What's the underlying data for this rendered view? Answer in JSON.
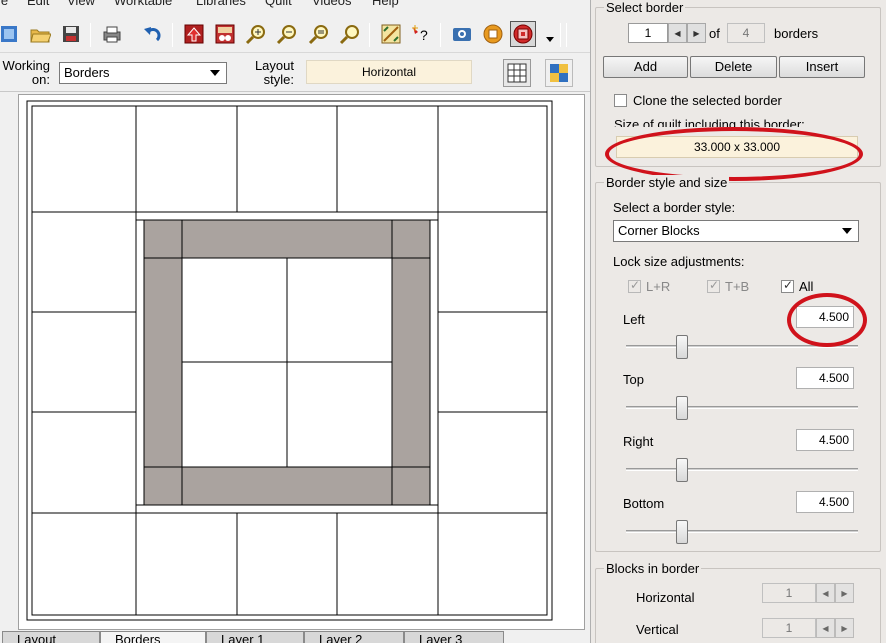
{
  "menu": {
    "items": [
      "le",
      "Edit",
      "View",
      "Worktable",
      "Libraries",
      "Quilt",
      "Videos",
      "Help"
    ]
  },
  "toolbar": {
    "icons": [
      "new-icon",
      "open-icon",
      "save-icon",
      "print-icon",
      "undo-icon",
      "add-to-sketchbook-icon",
      "view-sketchbook-icon",
      "zoom-in-icon",
      "zoom-out-icon",
      "fit-to-worktable-icon",
      "refresh-icon",
      "color-palette-icon",
      "help-icon",
      "camera-icon",
      "draw-icon",
      "target-icon"
    ]
  },
  "workbar": {
    "working_on_label": "Working on:",
    "working_on_value": "Borders",
    "layout_style_label": "Layout style:",
    "layout_style_value": "Horizontal"
  },
  "bottom_tabs": [
    "Layout",
    "Borders",
    "Layer 1",
    "Layer 2",
    "Layer 3"
  ],
  "active_tab": "Borders",
  "select_border": {
    "title": "Select border",
    "current": "1",
    "of_label": "of",
    "total": "4",
    "borders_label": "borders",
    "add_label": "Add",
    "delete_label": "Delete",
    "insert_label": "Insert",
    "clone_label": "Clone the selected border",
    "clone_checked": false,
    "size_label": "Size of quilt including this border:",
    "size_value": "33.000 x 33.000"
  },
  "border_style": {
    "title": "Border style and size",
    "select_label": "Select a border style:",
    "style_value": "Corner Blocks",
    "lock_label": "Lock size adjustments:",
    "lock_lr_label": "L+R",
    "lock_tb_label": "T+B",
    "lock_all_label": "All",
    "lock_lr_checked": true,
    "lock_tb_checked": true,
    "lock_all_checked": true,
    "sliders": [
      {
        "label": "Left",
        "value": "4.500"
      },
      {
        "label": "Top",
        "value": "4.500"
      },
      {
        "label": "Right",
        "value": "4.500"
      },
      {
        "label": "Bottom",
        "value": "4.500"
      }
    ],
    "slider_fraction": 0.24
  },
  "blocks_in_border": {
    "title": "Blocks in border",
    "horizontal_label": "Horizontal",
    "horizontal_value": "1",
    "vertical_label": "Vertical",
    "vertical_value": "1"
  },
  "colors": {
    "border_fabric": "#aaa39f",
    "highlight": "#d0121b",
    "field_bg": "#fbf2dc"
  }
}
